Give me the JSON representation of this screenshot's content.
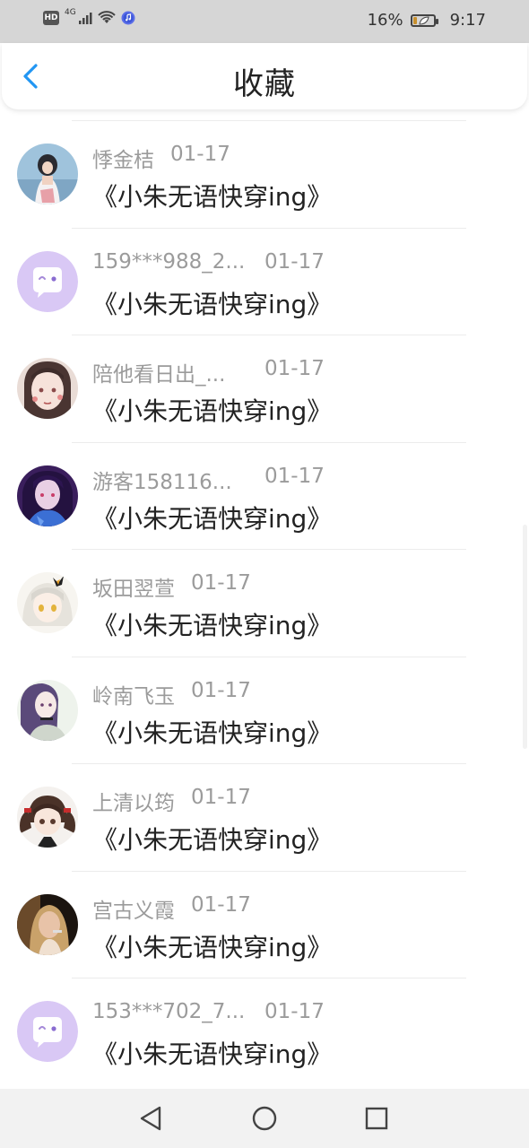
{
  "status_bar": {
    "hd": "HD",
    "network": "4G",
    "battery_text": "16%",
    "battery_level": 0.16,
    "time": "9:17"
  },
  "header": {
    "title": "收藏",
    "back_icon": "chevron-left-icon"
  },
  "items": [
    {
      "name": "悸金桔",
      "date": "01-17",
      "book": "《小朱无语快穿ing》",
      "avatar": "photo-girl-lake"
    },
    {
      "name": "159***988_2...",
      "date": "01-17",
      "book": "《小朱无语快穿ing》",
      "avatar": "default-chat-bubble"
    },
    {
      "name": "陪他看日出_...",
      "date": "01-17",
      "book": "《小朱无语快穿ing》",
      "avatar": "anime-girl-flowers"
    },
    {
      "name": "游客158116...",
      "date": "01-17",
      "book": "《小朱无语快穿ing》",
      "avatar": "anime-boy-purple"
    },
    {
      "name": "坂田翌萱",
      "date": "01-17",
      "book": "《小朱无语快穿ing》",
      "avatar": "anime-girl-white-hair"
    },
    {
      "name": "岭南飞玉",
      "date": "01-17",
      "book": "《小朱无语快穿ing》",
      "avatar": "anime-girl-choker"
    },
    {
      "name": "上清以筠",
      "date": "01-17",
      "book": "《小朱无语快穿ing》",
      "avatar": "anime-girl-twintails"
    },
    {
      "name": "宫古义霞",
      "date": "01-17",
      "book": "《小朱无语快穿ing》",
      "avatar": "photo-girl-blonde"
    },
    {
      "name": "153***702_7...",
      "date": "01-17",
      "book": "《小朱无语快穿ing》",
      "avatar": "default-chat-bubble"
    }
  ],
  "nav_bar": {
    "back_icon": "triangle-back-icon",
    "home_icon": "circle-home-icon",
    "recents_icon": "square-recents-icon"
  },
  "colors": {
    "accent": "#2196f3",
    "status_bar_bg": "#d6d6d6",
    "meta_text": "#9b9b9b",
    "default_avatar": "#d9c8f5"
  }
}
